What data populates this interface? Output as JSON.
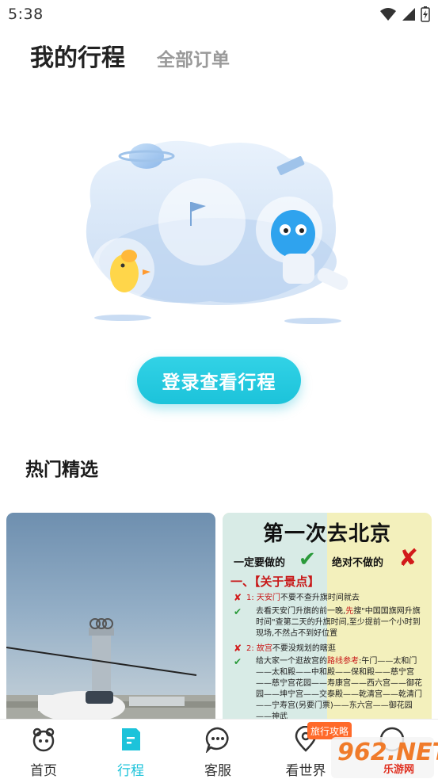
{
  "status_bar": {
    "time": "5:38"
  },
  "header": {
    "tab_active": "我的行程",
    "tab_inactive": "全部订单"
  },
  "login_button": "登录查看行程",
  "section_title": "热门精选",
  "guide_card": {
    "title": "第一次去北京",
    "must_do": "一定要做的",
    "never_do": "绝对不做的",
    "section": "一、【关于景点】",
    "items": [
      {
        "num": "1:",
        "highlight": "天安门",
        "text": "不要不查升旗时间就去"
      },
      {
        "text_a": "去看天安门升旗的前一晚,",
        "highlight": "先",
        "text_b": "搜\"中国国旗网升旗时间\"查第二天的升旗时间,至少提前一个小时到现场,不然占不到好位置"
      },
      {
        "num": "2:",
        "highlight": "故宫",
        "text": "不要没规划的瞎逛"
      },
      {
        "text_a": "给大家一个逛故宫的",
        "highlight": "路线参考",
        "text_b": ":午门——太和门——太和殿——中和殿——保和殿——慈宁宫——慈宁宫花园——寿康宫——西六宫——御花园——坤宁宫——交泰殿——乾清宫——乾清门——宁寿宫(另要门票)——东六宫——御花园——神武"
      }
    ]
  },
  "bottom_nav": [
    {
      "label": "首页",
      "icon": "home-icon",
      "active": false
    },
    {
      "label": "行程",
      "icon": "itinerary-icon",
      "active": true
    },
    {
      "label": "客服",
      "icon": "customer-service-icon",
      "active": false
    },
    {
      "label": "看世界",
      "icon": "explore-icon",
      "active": false
    }
  ],
  "ad_badge": "旅行攻略",
  "watermark": {
    "big": "962.NET",
    "small": "乐游网"
  },
  "colors": {
    "accent": "#1cc3da",
    "inactive_tab": "#9a9a9a",
    "guide_red": "#c81818"
  }
}
